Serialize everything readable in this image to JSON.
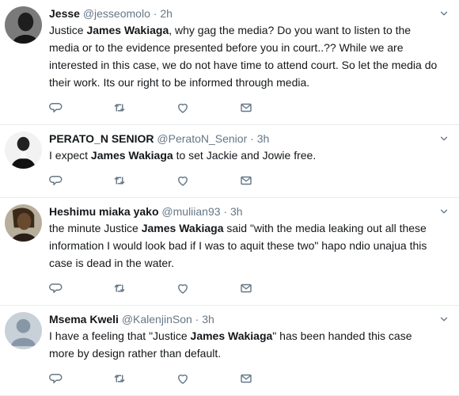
{
  "tweets": [
    {
      "name": "Jesse",
      "handle": "@jesseomolo",
      "time": "2h",
      "text_parts": [
        {
          "t": "Justice ",
          "bold": false
        },
        {
          "t": "James Wakiaga",
          "bold": true
        },
        {
          "t": ", why gag the media? Do you want to listen to the media or to the evidence presented before you in court..?? While we are interested in this case, we do not have time to attend court. So let the media do their work. Its our right to be informed through media.",
          "bold": false
        }
      ]
    },
    {
      "name": "PERATO_N SENIOR",
      "handle": "@PeratoN_Senior",
      "time": "3h",
      "text_parts": [
        {
          "t": "I expect ",
          "bold": false
        },
        {
          "t": "James Wakiaga",
          "bold": true
        },
        {
          "t": " to set Jackie  and Jowie free.",
          "bold": false
        }
      ]
    },
    {
      "name": "Heshimu miaka yako",
      "handle": "@muliian93",
      "time": "3h",
      "text_parts": [
        {
          "t": "the minute Justice ",
          "bold": false
        },
        {
          "t": "James Wakiaga",
          "bold": true
        },
        {
          "t": " said \"with the media leaking out all these information I would look bad if I was to aquit these two\" hapo ndio unajua this case is dead in the water.",
          "bold": false
        }
      ]
    },
    {
      "name": "Msema Kweli",
      "handle": "@KalenjinSon",
      "time": "3h",
      "text_parts": [
        {
          "t": "I have a feeling that \"Justice ",
          "bold": false
        },
        {
          "t": "James Wakiaga",
          "bold": true
        },
        {
          "t": "\" has been handed this case more by design rather than default.",
          "bold": false
        }
      ]
    }
  ],
  "icons": {
    "reply": "reply-icon",
    "retweet": "retweet-icon",
    "like": "like-icon",
    "message": "direct-message-icon",
    "caret": "chevron-down-icon"
  },
  "colors": {
    "text": "#14171a",
    "muted": "#657786",
    "icon": "#657786",
    "divider": "#e6ecf0"
  }
}
